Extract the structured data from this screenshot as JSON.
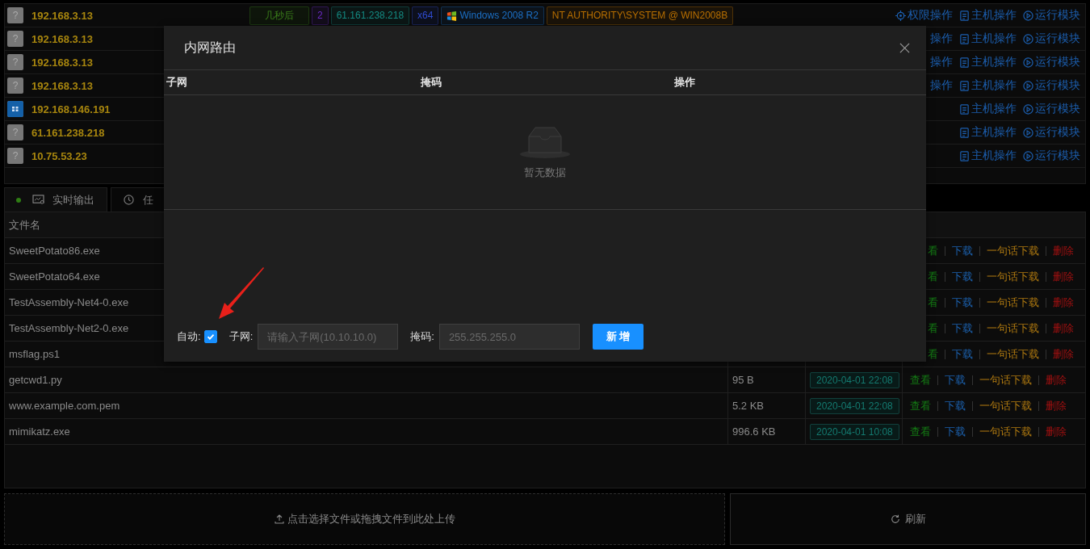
{
  "hosts": [
    {
      "kind": "unknown",
      "badge": "?",
      "ip": "192.168.3.13",
      "tags": [
        {
          "kind": "plain",
          "text": "几秒后",
          "color": "#3a7d1a"
        },
        {
          "kind": "plain",
          "text": "2",
          "color": "#6a2bc4"
        },
        {
          "kind": "plain",
          "text": "61.161.238.218",
          "color": "#148a82"
        },
        {
          "kind": "plain",
          "text": "x64",
          "color": "#2f4bd0"
        },
        {
          "kind": "os",
          "text": "Windows 2008 R2",
          "color": "#1c6fc4"
        },
        {
          "kind": "plain",
          "text": "NT AUTHORITY\\SYSTEM @ WIN2008B",
          "color": "#b86f00"
        }
      ],
      "actions": [
        {
          "kind": "priv",
          "label": "权限操作"
        },
        {
          "kind": "host",
          "label": "主机操作"
        },
        {
          "kind": "module",
          "label": "运行模块"
        }
      ]
    },
    {
      "kind": "unknown",
      "badge": "?",
      "ip": "192.168.3.13",
      "actions": [
        {
          "kind": "cut",
          "label": "操作"
        },
        {
          "kind": "host",
          "label": "主机操作"
        },
        {
          "kind": "module",
          "label": "运行模块"
        }
      ]
    },
    {
      "kind": "unknown",
      "badge": "?",
      "ip": "192.168.3.13",
      "actions": [
        {
          "kind": "cut",
          "label": "操作"
        },
        {
          "kind": "host",
          "label": "主机操作"
        },
        {
          "kind": "module",
          "label": "运行模块"
        }
      ]
    },
    {
      "kind": "unknown",
      "badge": "?",
      "ip": "192.168.3.13",
      "actions": [
        {
          "kind": "cut",
          "label": "操作"
        },
        {
          "kind": "host",
          "label": "主机操作"
        },
        {
          "kind": "module",
          "label": "运行模块"
        }
      ]
    },
    {
      "kind": "windows",
      "ip": "192.168.146.191",
      "actions": [
        {
          "kind": "host",
          "label": "主机操作"
        },
        {
          "kind": "module",
          "label": "运行模块"
        }
      ]
    },
    {
      "kind": "unknown",
      "badge": "?",
      "ip": "61.161.238.218",
      "actions": [
        {
          "kind": "host",
          "label": "主机操作"
        },
        {
          "kind": "module",
          "label": "运行模块"
        }
      ]
    },
    {
      "kind": "unknown",
      "badge": "?",
      "ip": "10.75.53.23",
      "actions": [
        {
          "kind": "host",
          "label": "主机操作"
        },
        {
          "kind": "module",
          "label": "运行模块"
        }
      ]
    }
  ],
  "tabs": [
    {
      "label": "实时输出",
      "live": true,
      "selected": true
    },
    {
      "label": "任",
      "live": false,
      "selected": false
    }
  ],
  "files": {
    "columns": [
      "文件名"
    ],
    "rows": [
      {
        "name": "SweetPotato86.exe",
        "actions": [
          {
            "kind": "view",
            "label": "看"
          },
          {
            "kind": "download",
            "label": "下载"
          },
          {
            "kind": "oneliner",
            "label": "一句话下载"
          },
          {
            "kind": "delete",
            "label": "删除"
          }
        ]
      },
      {
        "name": "SweetPotato64.exe",
        "actions": [
          {
            "kind": "view",
            "label": "看"
          },
          {
            "kind": "download",
            "label": "下载"
          },
          {
            "kind": "oneliner",
            "label": "一句话下载"
          },
          {
            "kind": "delete",
            "label": "删除"
          }
        ]
      },
      {
        "name": "TestAssembly-Net4-0.exe",
        "actions": [
          {
            "kind": "view",
            "label": "看"
          },
          {
            "kind": "download",
            "label": "下载"
          },
          {
            "kind": "oneliner",
            "label": "一句话下载"
          },
          {
            "kind": "delete",
            "label": "删除"
          }
        ]
      },
      {
        "name": "TestAssembly-Net2-0.exe",
        "actions": [
          {
            "kind": "view",
            "label": "看"
          },
          {
            "kind": "download",
            "label": "下载"
          },
          {
            "kind": "oneliner",
            "label": "一句话下载"
          },
          {
            "kind": "delete",
            "label": "删除"
          }
        ]
      },
      {
        "name": "msflag.ps1",
        "actions": [
          {
            "kind": "view",
            "label": "看"
          },
          {
            "kind": "download",
            "label": "下载"
          },
          {
            "kind": "oneliner",
            "label": "一句话下载"
          },
          {
            "kind": "delete",
            "label": "删除"
          }
        ]
      },
      {
        "name": "getcwd1.py",
        "size": "95 B",
        "time": "2020-04-01 22:08",
        "actions": [
          {
            "kind": "view",
            "label": "查看"
          },
          {
            "kind": "download",
            "label": "下载"
          },
          {
            "kind": "oneliner",
            "label": "一句话下载"
          },
          {
            "kind": "delete",
            "label": "删除"
          }
        ]
      },
      {
        "name": "www.example.com.pem",
        "size": "5.2 KB",
        "time": "2020-04-01 22:08",
        "actions": [
          {
            "kind": "view",
            "label": "查看"
          },
          {
            "kind": "download",
            "label": "下载"
          },
          {
            "kind": "oneliner",
            "label": "一句话下载"
          },
          {
            "kind": "delete",
            "label": "删除"
          }
        ]
      },
      {
        "name": "mimikatz.exe",
        "size": "996.6 KB",
        "time": "2020-04-01 10:08",
        "actions": [
          {
            "kind": "view",
            "label": "查看"
          },
          {
            "kind": "download",
            "label": "下载"
          },
          {
            "kind": "oneliner",
            "label": "一句话下载"
          },
          {
            "kind": "delete",
            "label": "删除"
          }
        ]
      }
    ]
  },
  "upload": {
    "label": "点击选择文件或拖拽文件到此处上传"
  },
  "refresh": {
    "label": "刷新"
  },
  "modal": {
    "title": "内网路由",
    "columns": [
      "子网",
      "掩码",
      "操作"
    ],
    "empty": "暂无数据",
    "form": {
      "auto": {
        "label": "自动:",
        "checked": true
      },
      "subnet": {
        "label": "子网:",
        "placeholder": "请输入子网(10.10.10.0)"
      },
      "mask": {
        "label": "掩码:",
        "placeholder": "255.255.255.0"
      },
      "add": "新 增"
    }
  }
}
